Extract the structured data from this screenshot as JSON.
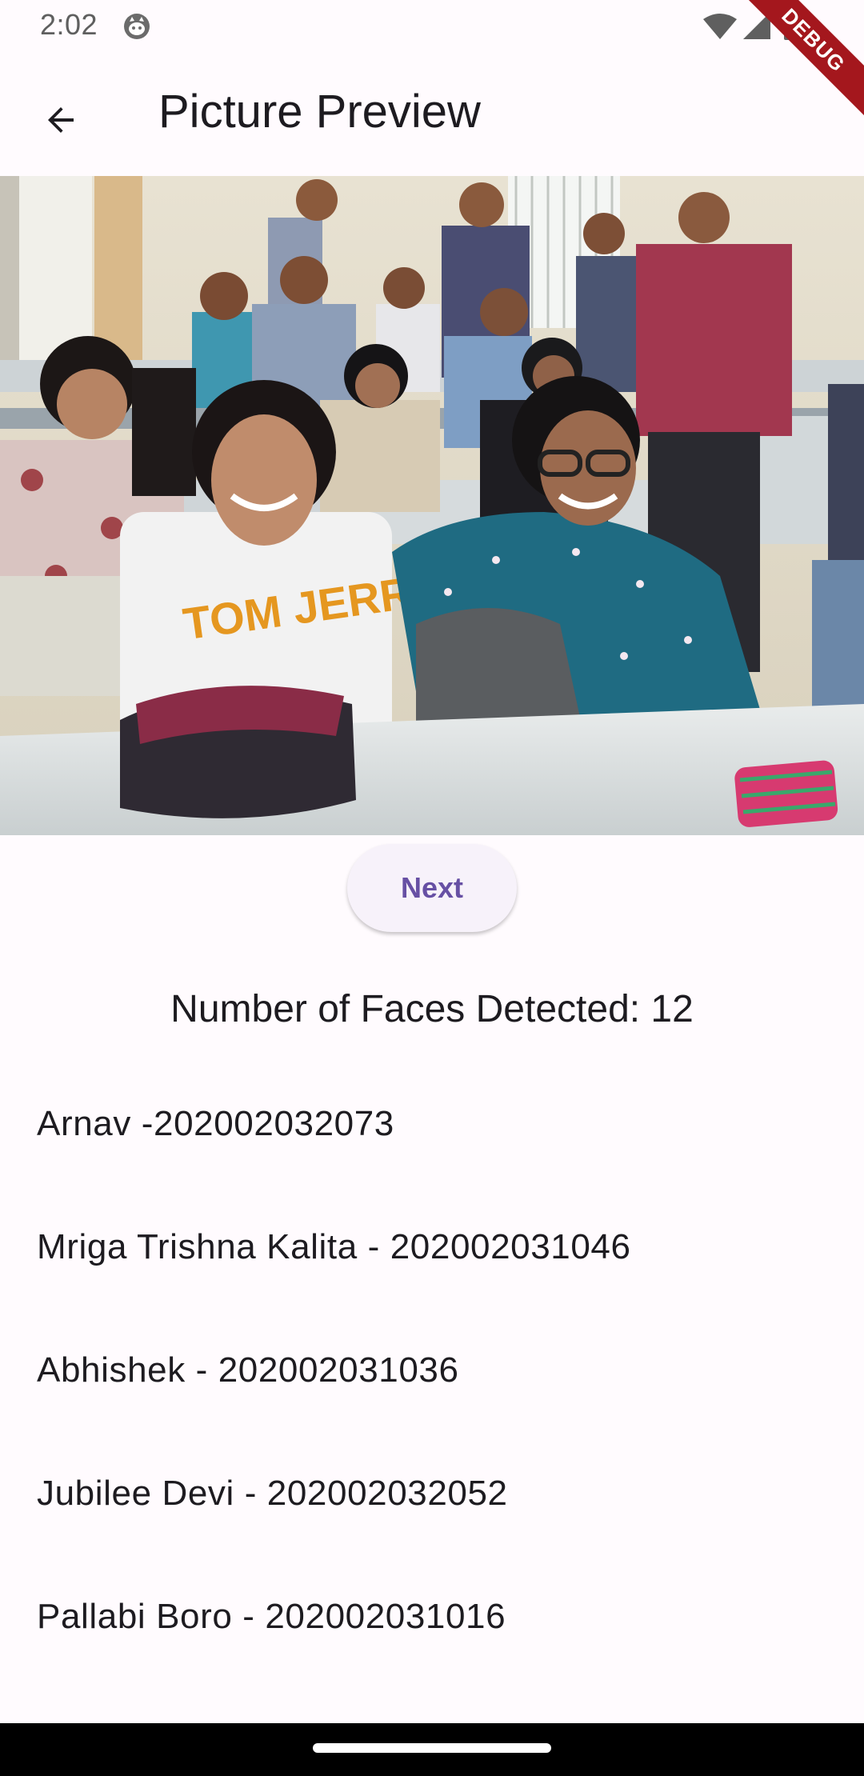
{
  "status_bar": {
    "time": "2:02"
  },
  "debug_banner": "DEBUG",
  "app_bar": {
    "title": "Picture Preview",
    "back_icon": "arrow-back-icon"
  },
  "next_button": {
    "label": "Next"
  },
  "faces_count_text": "Number of Faces Detected: 12",
  "faces": [
    "Arnav -202002032073",
    "Mriga Trishna Kalita - 202002031046",
    "Abhishek - 202002031036",
    "Jubilee Devi - 202002032052",
    "Pallabi Boro - 202002031016"
  ],
  "colors": {
    "background": "#fffbfe",
    "primary": "#6750a4",
    "button_surface": "#f7f2fa",
    "debug_banner": "#a4171d"
  }
}
